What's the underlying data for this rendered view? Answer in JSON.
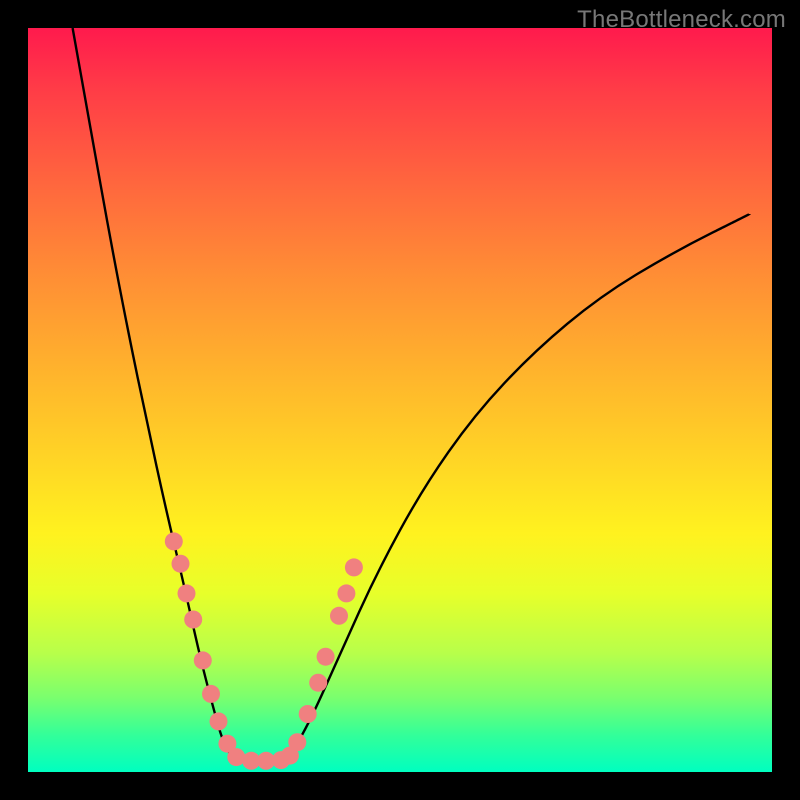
{
  "watermark": "TheBottleneck.com",
  "chart_data": {
    "type": "line",
    "title": "",
    "xlabel": "",
    "ylabel": "",
    "xlim": [
      0,
      1
    ],
    "ylim": [
      0,
      1
    ],
    "series": [
      {
        "name": "curve-left",
        "x": [
          0.06,
          0.085,
          0.11,
          0.135,
          0.16,
          0.185,
          0.21,
          0.23,
          0.248,
          0.262,
          0.275
        ],
        "y": [
          1.0,
          0.86,
          0.72,
          0.59,
          0.47,
          0.355,
          0.25,
          0.16,
          0.09,
          0.04,
          0.018
        ]
      },
      {
        "name": "plateau",
        "x": [
          0.275,
          0.3,
          0.325,
          0.35
        ],
        "y": [
          0.018,
          0.015,
          0.015,
          0.018
        ]
      },
      {
        "name": "curve-right",
        "x": [
          0.35,
          0.38,
          0.42,
          0.47,
          0.53,
          0.6,
          0.68,
          0.77,
          0.87,
          0.97
        ],
        "y": [
          0.018,
          0.07,
          0.16,
          0.27,
          0.38,
          0.48,
          0.565,
          0.64,
          0.7,
          0.75
        ]
      }
    ],
    "markers": {
      "name": "highlight-dots",
      "color": "#f08080",
      "points": [
        {
          "x": 0.196,
          "y": 0.31
        },
        {
          "x": 0.205,
          "y": 0.28
        },
        {
          "x": 0.213,
          "y": 0.24
        },
        {
          "x": 0.222,
          "y": 0.205
        },
        {
          "x": 0.235,
          "y": 0.15
        },
        {
          "x": 0.246,
          "y": 0.105
        },
        {
          "x": 0.256,
          "y": 0.068
        },
        {
          "x": 0.268,
          "y": 0.038
        },
        {
          "x": 0.28,
          "y": 0.02
        },
        {
          "x": 0.3,
          "y": 0.015
        },
        {
          "x": 0.32,
          "y": 0.015
        },
        {
          "x": 0.34,
          "y": 0.016
        },
        {
          "x": 0.352,
          "y": 0.022
        },
        {
          "x": 0.362,
          "y": 0.04
        },
        {
          "x": 0.376,
          "y": 0.078
        },
        {
          "x": 0.39,
          "y": 0.12
        },
        {
          "x": 0.4,
          "y": 0.155
        },
        {
          "x": 0.418,
          "y": 0.21
        },
        {
          "x": 0.428,
          "y": 0.24
        },
        {
          "x": 0.438,
          "y": 0.275
        }
      ]
    }
  }
}
